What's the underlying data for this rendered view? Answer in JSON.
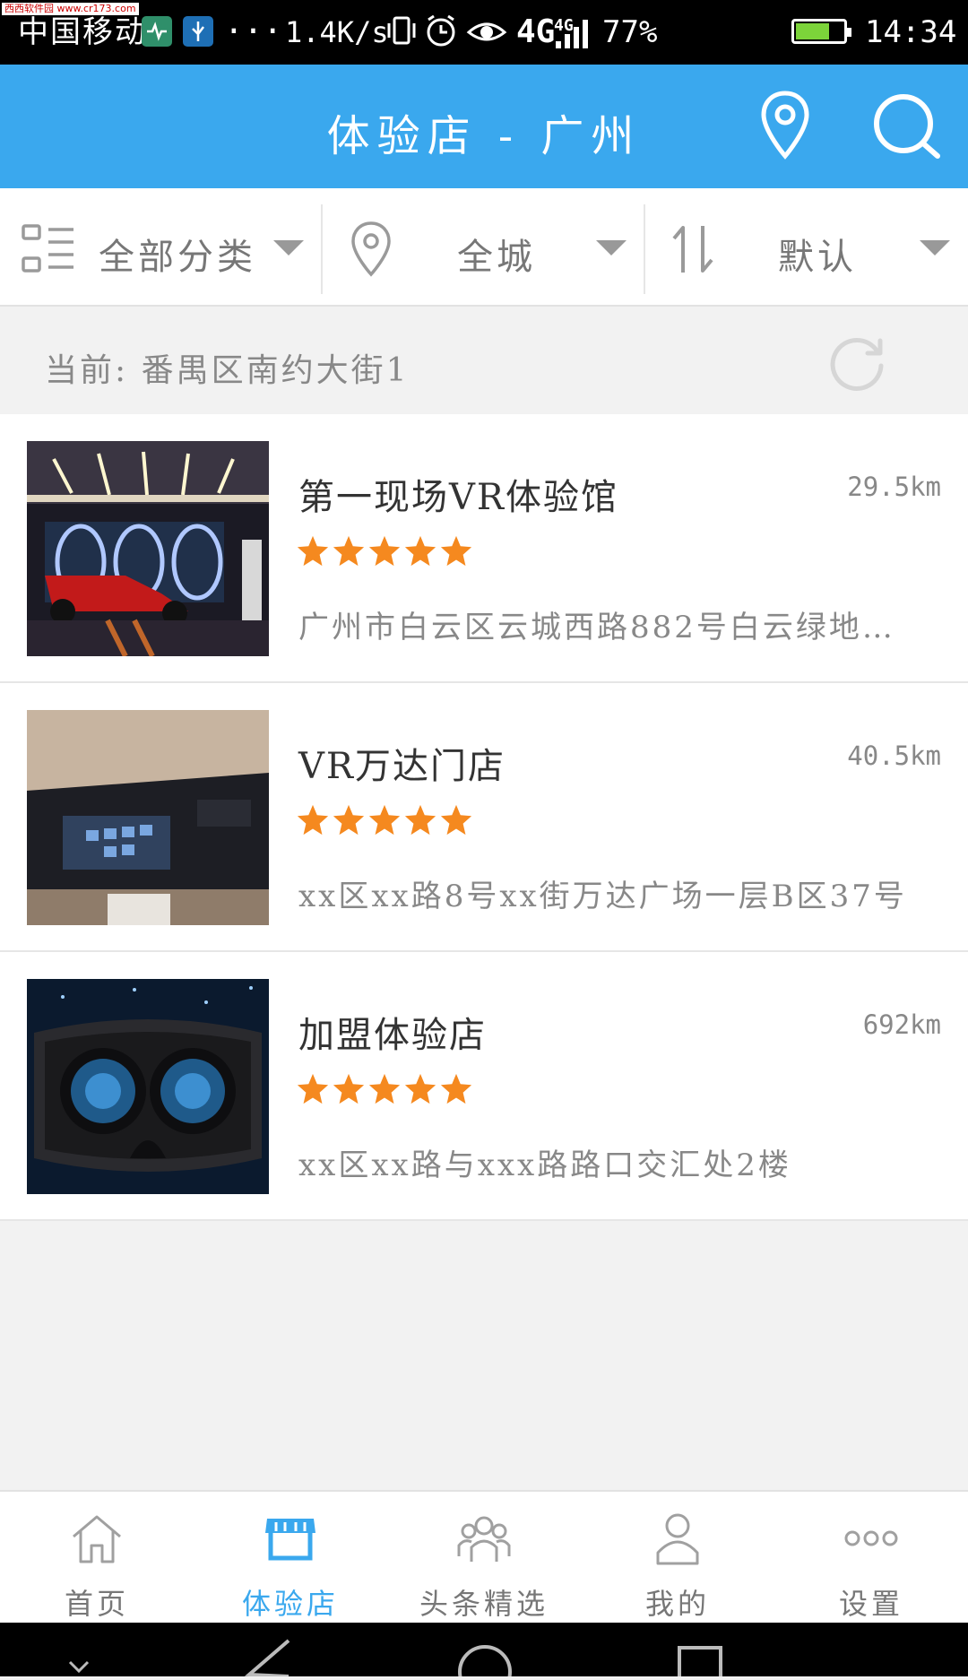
{
  "status_bar": {
    "watermark": "西西软件园 www.cr173.com",
    "carrier": "中国移动",
    "more": "···",
    "speed": "1.4K/s",
    "network": "4G",
    "network_small": "4G",
    "battery_percent": "77%",
    "battery_level": 0.77,
    "time": "14:34"
  },
  "header": {
    "title": "体验店 - 广州",
    "location_icon": "map-pin-icon",
    "search_icon": "search-icon",
    "accent_color": "#3aa8ee"
  },
  "filters": {
    "category": "全部分类",
    "area": "全城",
    "sort": "默认"
  },
  "location": {
    "text": "当前: 番禺区南约大街1"
  },
  "stores": [
    {
      "name": "第一现场VR体验馆",
      "distance": "29.5km",
      "rating": 5,
      "address": "广州市白云区云城西路882号白云绿地…"
    },
    {
      "name": "VR万达门店",
      "distance": "40.5km",
      "rating": 5,
      "address": "xx区xx路8号xx街万达广场一层B区37号"
    },
    {
      "name": "加盟体验店",
      "distance": "692km",
      "rating": 5,
      "address": "xx区xx路与xxx路路口交汇处2楼"
    }
  ],
  "tabs": [
    {
      "label": "首页",
      "icon": "home-icon",
      "active": false
    },
    {
      "label": "体验店",
      "icon": "store-icon",
      "active": true
    },
    {
      "label": "头条精选",
      "icon": "group-icon",
      "active": false
    },
    {
      "label": "我的",
      "icon": "person-icon",
      "active": false
    },
    {
      "label": "设置",
      "icon": "more-dots-icon",
      "active": false
    }
  ],
  "colors": {
    "accent": "#3aa8ee",
    "star": "#f5891f",
    "background": "#f2f2f2"
  }
}
